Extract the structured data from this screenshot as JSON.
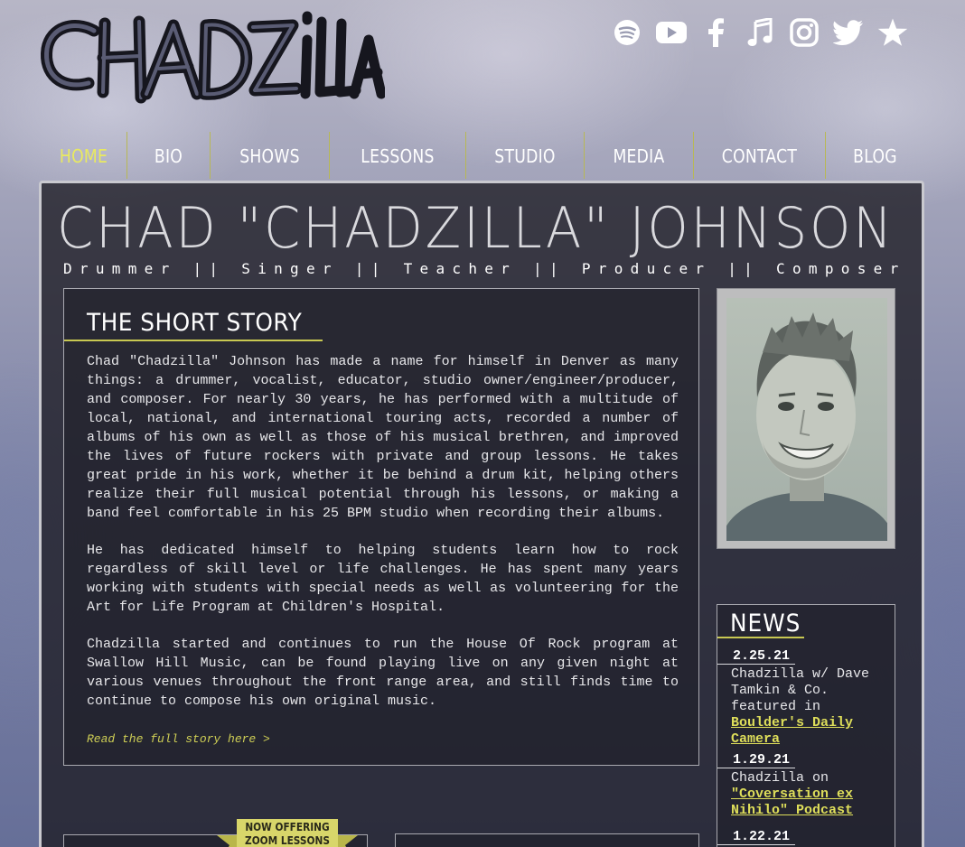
{
  "header": {
    "logo_text": "Chadzilla",
    "social": [
      {
        "name": "Spotify",
        "icon": "spotify-icon"
      },
      {
        "name": "YouTube",
        "icon": "youtube-icon"
      },
      {
        "name": "Facebook",
        "icon": "facebook-icon"
      },
      {
        "name": "Music",
        "icon": "music-note-icon"
      },
      {
        "name": "Instagram",
        "icon": "instagram-icon"
      },
      {
        "name": "Twitter",
        "icon": "twitter-icon"
      },
      {
        "name": "ReverbNation",
        "icon": "star-icon"
      }
    ]
  },
  "nav": {
    "items": [
      "HOME",
      "BIO",
      "SHOWS",
      "LESSONS",
      "STUDIO",
      "MEDIA",
      "CONTACT",
      "BLOG"
    ],
    "active": "HOME"
  },
  "main": {
    "title": "CHAD \"CHADZILLA\" JOHNSON",
    "subtitle": "Drummer || Singer || Teacher || Producer || Composer"
  },
  "story": {
    "heading": "THE SHORT STORY",
    "paragraphs": [
      "Chad \"Chadzilla\" Johnson has made a name for himself in Denver as many things: a drummer, vocalist, educator, studio owner/engineer/producer, and composer. For nearly 30 years, he has performed with a multitude of local, national, and international touring acts, recorded a number of albums of his own as well as those of his musical brethren, and improved the lives of future rockers with private and group lessons. He takes great pride in his work, whether it be behind a drum kit, helping others realize their full musical potential through his lessons, or making a band feel comfortable in his 25 BPM studio when recording their albums.",
      "He has dedicated himself to helping students learn how to rock regardless of skill level or life challenges. He has spent many years working with students with special needs as well as volunteering for the Art for Life Program at Children's Hospital.",
      "Chadzilla started and continues to run the House Of Rock program at Swallow Hill Music, can be found playing live on any given night at various venues throughout the front range area, and still finds time to continue to compose his own original music."
    ],
    "read_more": "Read the full story here >"
  },
  "news": {
    "heading": "NEWS",
    "items": [
      {
        "date": "2.25.21",
        "text": "Chadzilla w/ Dave Tamkin & Co. featured in ",
        "link": "Boulder's Daily Camera"
      },
      {
        "date": "1.29.21",
        "text": "Chadzilla on ",
        "link": "\"Coversation ex Nihilo\" Podcast"
      },
      {
        "date": "1.22.21",
        "text": "",
        "link": ""
      }
    ]
  },
  "promo": {
    "badge_line1": "NOW OFFERING",
    "badge_line2": "ZOOM LESSONS"
  },
  "colors": {
    "accent": "#e9ea5f",
    "panel": "#1c1b23",
    "link": "#dede5a"
  }
}
